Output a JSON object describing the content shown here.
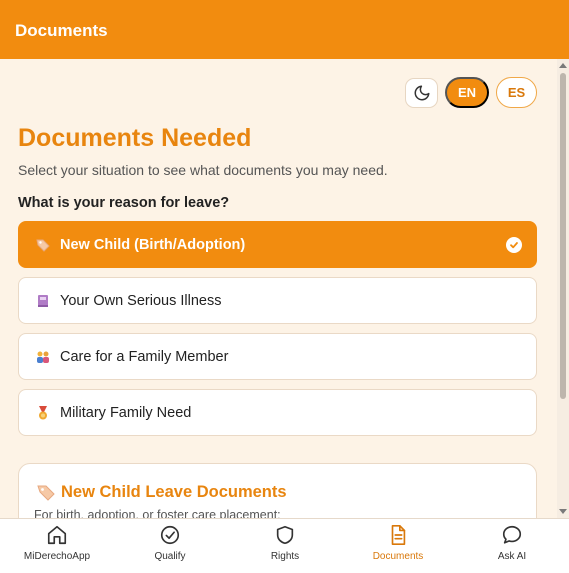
{
  "header": {
    "title": "Documents"
  },
  "controls": {
    "theme_icon": "moon-icon",
    "lang_en": "EN",
    "lang_es": "ES",
    "active_language": "EN"
  },
  "main": {
    "title": "Documents Needed",
    "subtitle": "Select your situation to see what documents you may need.",
    "question": "What is your reason for leave?",
    "options": [
      {
        "label": "New Child (Birth/Adoption)",
        "icon": "tag-icon",
        "selected": true
      },
      {
        "label": "Your Own Serious Illness",
        "icon": "book-icon",
        "selected": false
      },
      {
        "label": "Care for a Family Member",
        "icon": "family-icon",
        "selected": false
      },
      {
        "label": "Military Family Need",
        "icon": "medal-icon",
        "selected": false
      }
    ],
    "card": {
      "title": "New Child Leave Documents",
      "description": "For birth, adoption, or foster care placement:",
      "icon": "tag-icon"
    }
  },
  "nav": {
    "items": [
      {
        "label": "MiDerechoApp",
        "icon": "home-icon"
      },
      {
        "label": "Qualify",
        "icon": "check-circle-icon"
      },
      {
        "label": "Rights",
        "icon": "shield-icon"
      },
      {
        "label": "Documents",
        "icon": "document-icon",
        "active": true
      },
      {
        "label": "Ask AI",
        "icon": "chat-icon"
      }
    ]
  },
  "colors": {
    "accent": "#f28c0f",
    "accent_text": "#e8850f",
    "background": "#fdf3e6",
    "card": "#ffffff"
  }
}
